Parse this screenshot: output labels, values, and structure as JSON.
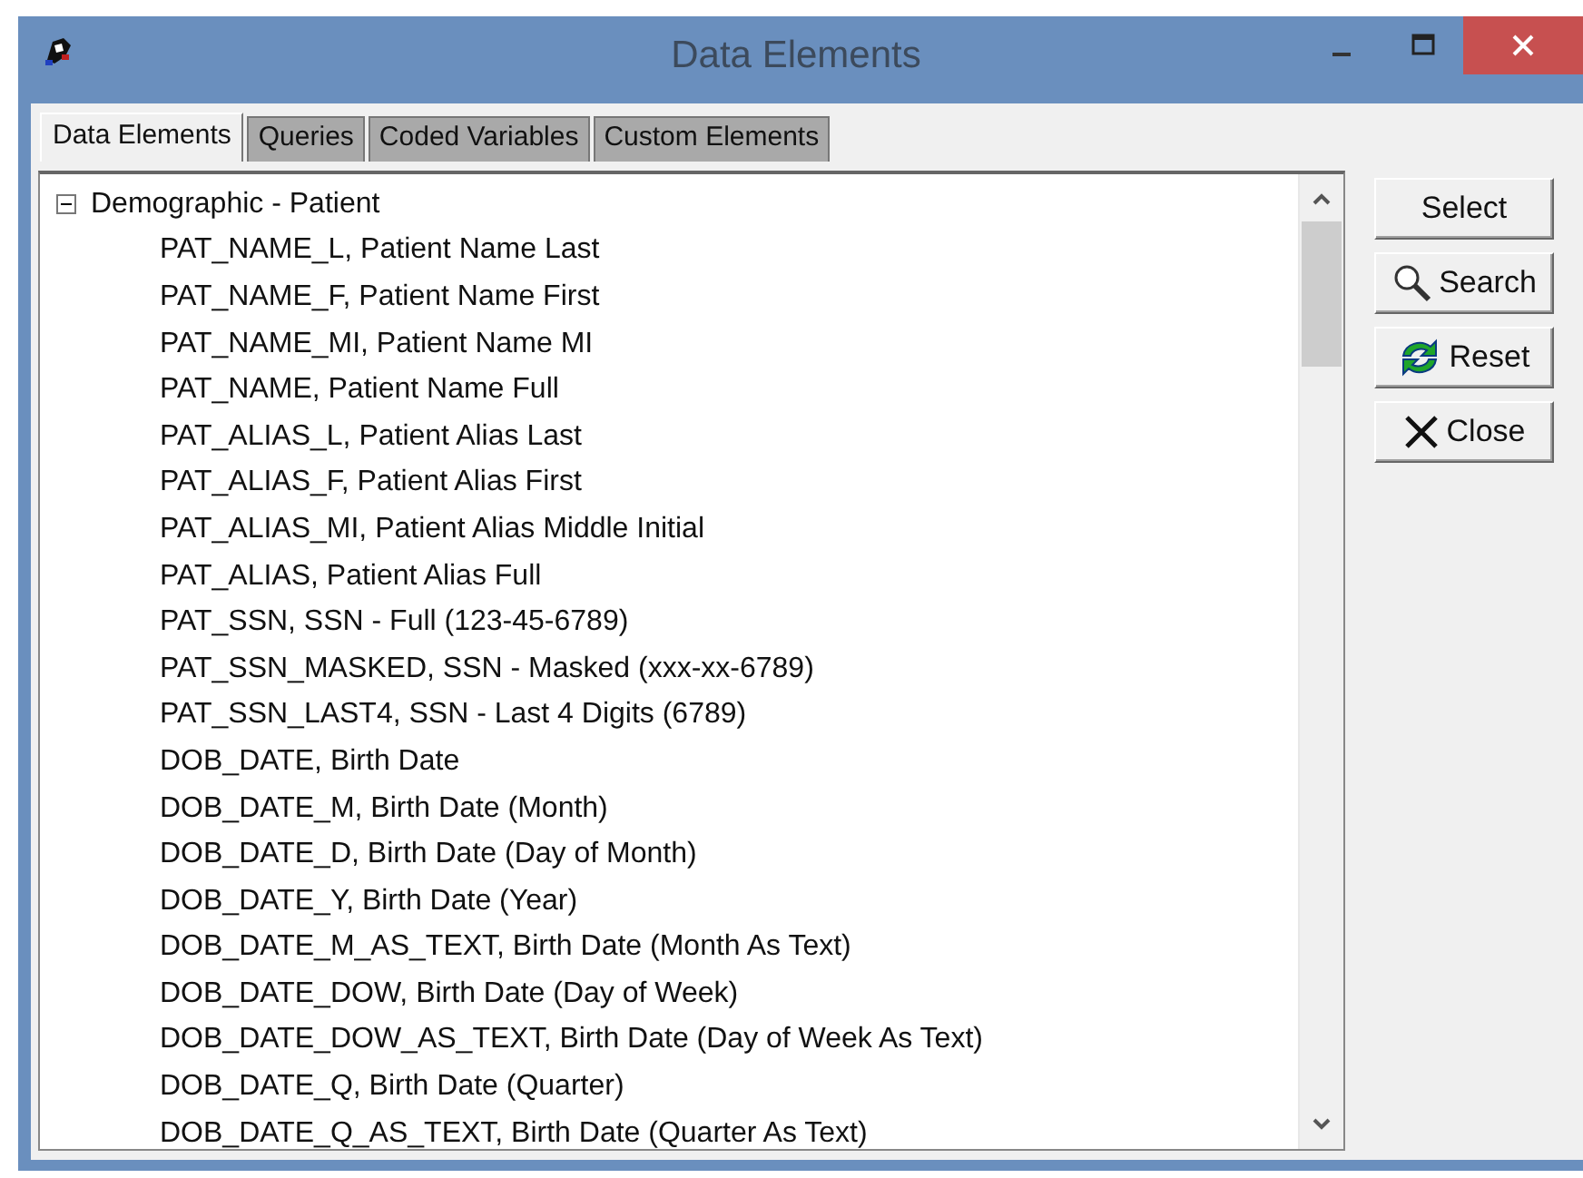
{
  "window": {
    "title": "Data Elements"
  },
  "tabs": [
    {
      "label": "Data Elements",
      "selected": true
    },
    {
      "label": "Queries",
      "selected": false
    },
    {
      "label": "Coded Variables",
      "selected": false
    },
    {
      "label": "Custom Elements",
      "selected": false
    }
  ],
  "tree": {
    "label": "Demographic - Patient",
    "expanded": true,
    "children": [
      {
        "label": "PAT_NAME_L, Patient Name Last"
      },
      {
        "label": "PAT_NAME_F, Patient Name First"
      },
      {
        "label": "PAT_NAME_MI, Patient Name MI"
      },
      {
        "label": "PAT_NAME, Patient Name Full"
      },
      {
        "label": "PAT_ALIAS_L, Patient Alias Last"
      },
      {
        "label": "PAT_ALIAS_F, Patient Alias First"
      },
      {
        "label": "PAT_ALIAS_MI, Patient Alias Middle Initial"
      },
      {
        "label": "PAT_ALIAS, Patient Alias Full"
      },
      {
        "label": "PAT_SSN, SSN - Full (123-45-6789)"
      },
      {
        "label": "PAT_SSN_MASKED, SSN - Masked (xxx-xx-6789)"
      },
      {
        "label": "PAT_SSN_LAST4, SSN - Last 4 Digits (6789)"
      },
      {
        "label": "DOB_DATE, Birth Date"
      },
      {
        "label": "DOB_DATE_M, Birth Date (Month)"
      },
      {
        "label": "DOB_DATE_D, Birth Date (Day of Month)"
      },
      {
        "label": "DOB_DATE_Y, Birth Date (Year)"
      },
      {
        "label": "DOB_DATE_M_AS_TEXT, Birth Date (Month As Text)"
      },
      {
        "label": "DOB_DATE_DOW, Birth Date (Day of Week)"
      },
      {
        "label": "DOB_DATE_DOW_AS_TEXT, Birth Date (Day of Week As Text)"
      },
      {
        "label": "DOB_DATE_Q, Birth Date (Quarter)"
      },
      {
        "label": "DOB_DATE_Q_AS_TEXT, Birth Date (Quarter As Text)"
      }
    ]
  },
  "buttons": [
    {
      "label": "Select",
      "kind": "plain"
    },
    {
      "label": "Search",
      "kind": "search"
    },
    {
      "label": "Reset",
      "kind": "reset"
    },
    {
      "label": "Close",
      "kind": "close"
    }
  ]
}
